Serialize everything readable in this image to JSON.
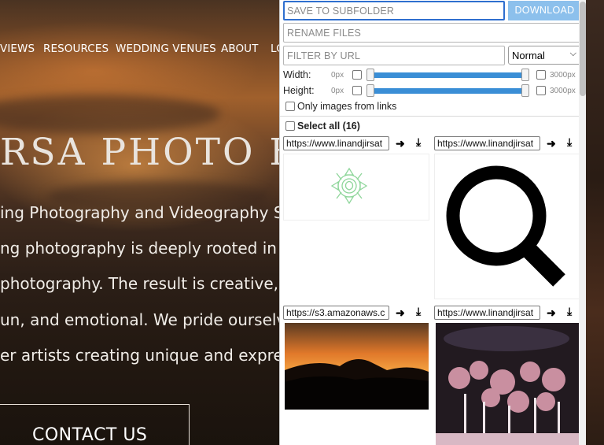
{
  "site": {
    "nav": [
      "VIEWS",
      "RESOURCES",
      "WEDDING VENUES",
      "ABOUT",
      "LO"
    ],
    "title": "RSA PHOTO BL",
    "body_lines": [
      "ing Photography and Videography Stud",
      "ng photography is deeply rooted in we",
      "photography. The result is creative, cle",
      "un, and emotional. We pride ourselves",
      "er artists creating unique and express"
    ],
    "contact_label": "CONTACT US"
  },
  "popup": {
    "subfolder_placeholder": "SAVE TO SUBFOLDER",
    "download_label": "DOWNLOAD",
    "rename_placeholder": "RENAME FILES",
    "filter_placeholder": "FILTER BY URL",
    "filter_mode": "Normal",
    "width_label": "Width:",
    "height_label": "Height:",
    "min_px": "0px",
    "max_px": "3000px",
    "only_links_label": "Only images from links",
    "select_all_label": "Select all (16)",
    "images": [
      {
        "url": "https://www.linandjirsat",
        "kind": "logo"
      },
      {
        "url": "https://www.linandjirsat",
        "kind": "search-icon"
      },
      {
        "url": "https://s3.amazonaws.c",
        "kind": "sunset-photo"
      },
      {
        "url": "https://www.linandjirsat",
        "kind": "flowers-photo"
      }
    ],
    "colors": {
      "accent": "#3a8ed6",
      "download_bg": "#8cc0ec",
      "focus": "#2f6fcf"
    }
  }
}
